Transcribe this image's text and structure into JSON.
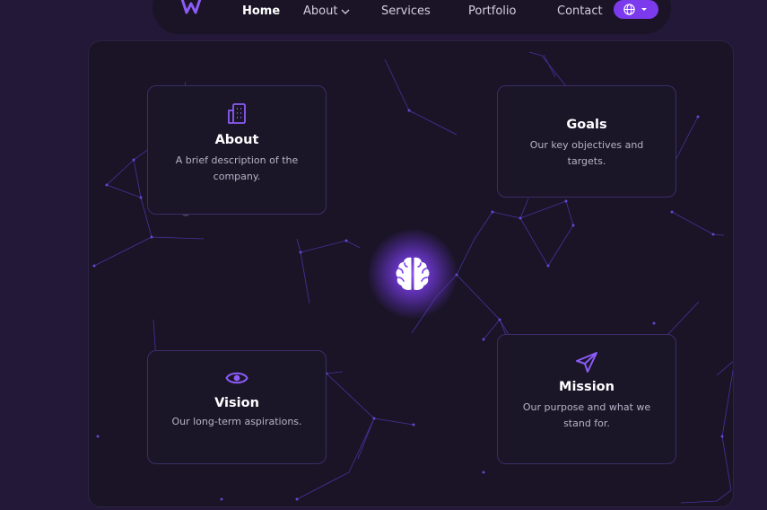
{
  "nav": {
    "logo_icon": "w-logo-icon",
    "links": [
      {
        "label": "Home",
        "active": true
      },
      {
        "label": "About",
        "dropdown": true
      },
      {
        "label": "Services"
      },
      {
        "label": "Portfolio"
      },
      {
        "label": "Contact"
      }
    ],
    "language_icon": "globe-icon",
    "accent_color": "#7c3aed"
  },
  "center": {
    "icon": "brain-icon"
  },
  "cards": [
    {
      "id": "about",
      "title": "About",
      "description": "A brief description of the company.",
      "icon": "building-icon"
    },
    {
      "id": "goals",
      "title": "Goals",
      "description": "Our key objectives and targets.",
      "icon": ""
    },
    {
      "id": "vision",
      "title": "Vision",
      "description": "Our long-term aspirations.",
      "icon": "eye-icon"
    },
    {
      "id": "mission",
      "title": "Mission",
      "description": "Our purpose and what we stand for.",
      "icon": "paper-plane-icon"
    }
  ],
  "colors": {
    "background": "#231838",
    "panel": "#1a1426",
    "card_border": "#3a2e68",
    "icon": "#8b5cf6"
  }
}
